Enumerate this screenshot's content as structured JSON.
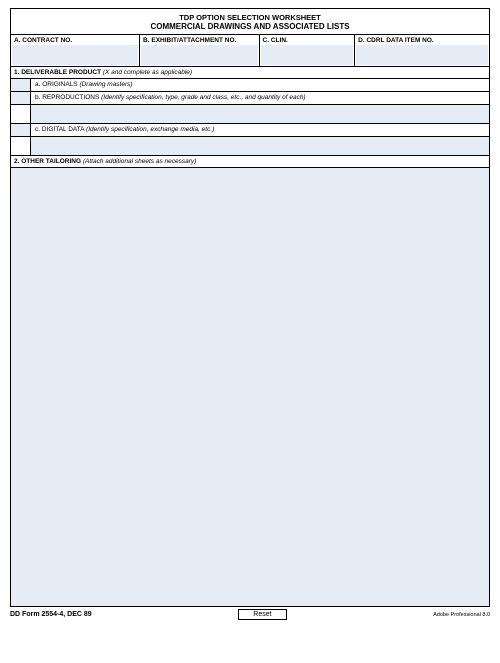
{
  "title": {
    "line1": "TDP OPTION SELECTION WORKSHEET",
    "line2": "COMMERCIAL DRAWINGS AND ASSOCIATED LISTS"
  },
  "header": {
    "a": {
      "label": "A.  CONTRACT NO."
    },
    "b": {
      "label": "B.  EXHIBIT/ATTACHMENT NO."
    },
    "c": {
      "label": "C.  CLIN."
    },
    "d": {
      "label": "D.  CDRL DATA ITEM NO."
    }
  },
  "section1": {
    "label": "1.  DELIVERABLE PRODUCT ",
    "hint": "(X and complete as applicable)",
    "a": {
      "label": "a.  ORIGINALS ",
      "hint": "(Drawing masters)"
    },
    "b": {
      "label": "b.  REPRODUCTIONS ",
      "hint": "(Identify specification, type, grade and class, etc., and quantity of each)"
    },
    "c": {
      "label": "c.  DIGITAL DATA ",
      "hint": "(Identify specification, exchange media, etc.)"
    }
  },
  "section2": {
    "label": "2.  OTHER TAILORING ",
    "hint": "(Attach additional sheets as necessary)"
  },
  "footer": {
    "form_id": "DD Form 2554-4, DEC 89",
    "reset": "Reset",
    "software": "Adobe Professional 8.0"
  }
}
